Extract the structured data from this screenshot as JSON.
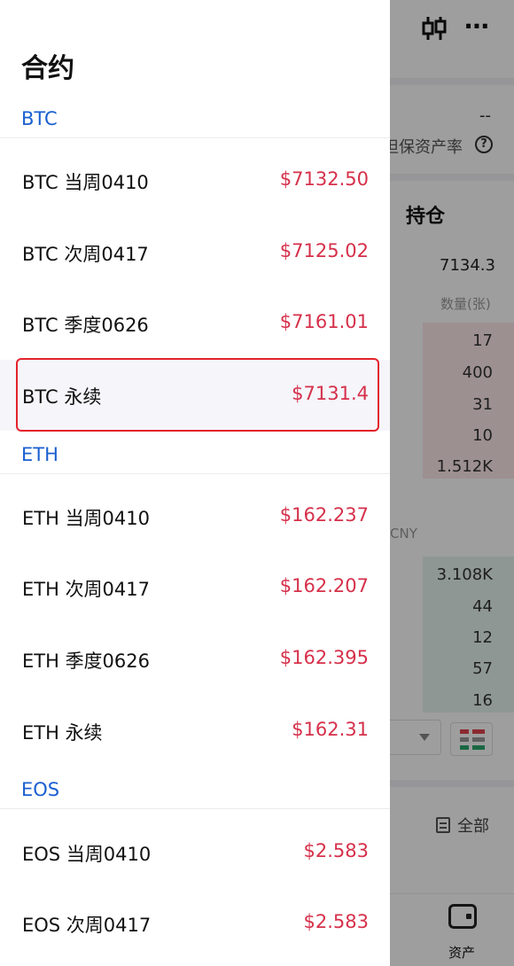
{
  "background": {
    "header_dash": "--",
    "margin_ratio_label": "担保资产率",
    "help_icon": "question-icon",
    "tab_label": "持仓",
    "last_price": "7134.3",
    "qty_header": "数量(张)",
    "asks": [
      "17",
      "400",
      "31",
      "10",
      "1.512K"
    ],
    "currency_label": "CNY",
    "bids": [
      "3.108K",
      "44",
      "12",
      "57",
      "16"
    ],
    "all_label": "全部",
    "nav_assets_label": "资产"
  },
  "drawer": {
    "title": "合约",
    "sections": [
      {
        "header": "BTC",
        "items": [
          {
            "name": "BTC 当周0410",
            "price": "$7132.50"
          },
          {
            "name": "BTC 次周0417",
            "price": "$7125.02"
          },
          {
            "name": "BTC 季度0626",
            "price": "$7161.01"
          },
          {
            "name": "BTC 永续",
            "price": "$7131.4"
          }
        ]
      },
      {
        "header": "ETH",
        "items": [
          {
            "name": "ETH 当周0410",
            "price": "$162.237"
          },
          {
            "name": "ETH 次周0417",
            "price": "$162.207"
          },
          {
            "name": "ETH 季度0626",
            "price": "$162.395"
          },
          {
            "name": "ETH 永续",
            "price": "$162.31"
          }
        ]
      },
      {
        "header": "EOS",
        "items": [
          {
            "name": "EOS 当周0410",
            "price": "$2.583"
          },
          {
            "name": "EOS 次周0417",
            "price": "$2.583"
          }
        ]
      }
    ]
  },
  "colors": {
    "section_header": "#1a5fd0",
    "price": "#d6304a",
    "highlight_border": "#e4222b"
  }
}
